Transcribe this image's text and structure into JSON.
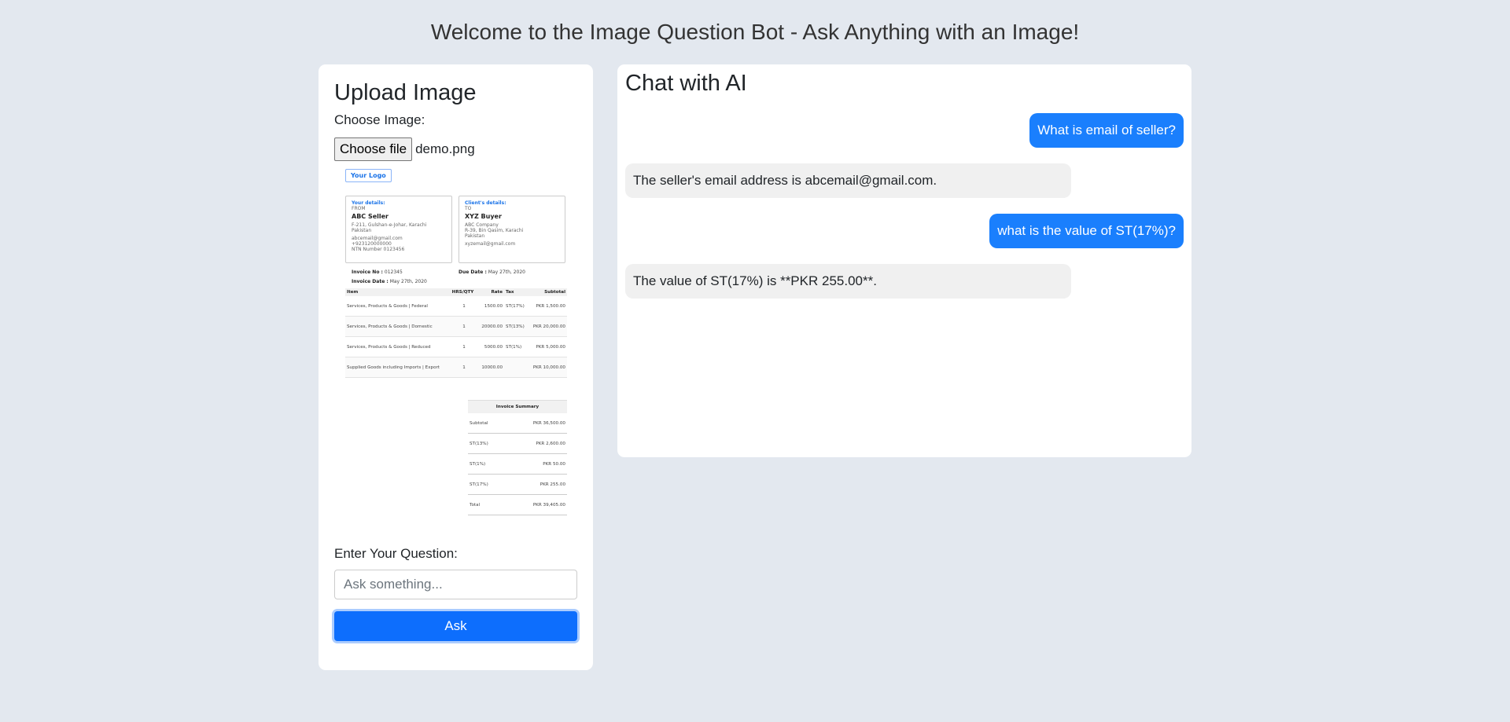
{
  "page": {
    "title": "Welcome to the Image Question Bot - Ask Anything with an Image!"
  },
  "upload": {
    "title": "Upload Image",
    "choose_label": "Choose Image:",
    "file_button": "Choose file",
    "file_name": "demo.png",
    "question_label": "Enter Your Question:",
    "question_placeholder": "Ask something...",
    "ask_button": "Ask"
  },
  "invoice": {
    "logo": "Your Logo",
    "seller": {
      "header": "Your details:",
      "from": "FROM",
      "name": "ABC Seller",
      "address1": "F-211, Gulshan-e-Johar, Karachi",
      "address2": "Pakistan",
      "email": "abcemail@gmail.com",
      "phone": "+923120000000",
      "ntn": "NTN Number 0123456"
    },
    "client": {
      "header": "Client's details:",
      "to": "TO",
      "name": "XYZ Buyer",
      "company": "ABC Company",
      "address1": "R-39, Bin Qasim, Karachi",
      "address2": "Pakistan",
      "email": "xyzemail@gmail.com"
    },
    "invoice_no_label": "Invoice No :",
    "invoice_no": "012345",
    "due_date_label": "Due Date :",
    "due_date": "May 27th, 2020",
    "invoice_date_label": "Invoice Date :",
    "invoice_date": "May 27th, 2020",
    "columns": [
      "Item",
      "HRS/QTY",
      "Rate",
      "Tax",
      "Subtotal"
    ],
    "rows": [
      {
        "item": "Services, Products & Goods | Federal",
        "qty": "1",
        "rate": "1500.00",
        "tax": "ST(17%)",
        "subtotal": "PKR 1,500.00"
      },
      {
        "item": "Services, Products & Goods | Domestic",
        "qty": "1",
        "rate": "20000.00",
        "tax": "ST(13%)",
        "subtotal": "PKR 20,000.00"
      },
      {
        "item": "Services, Products & Goods | Reduced",
        "qty": "1",
        "rate": "5000.00",
        "tax": "ST(1%)",
        "subtotal": "PKR 5,000.00"
      },
      {
        "item": "Supplied Goods including Imports | Export",
        "qty": "1",
        "rate": "10000.00",
        "tax": "",
        "subtotal": "PKR 10,000.00"
      }
    ],
    "summary_title": "Invoice Summary",
    "summary": [
      {
        "label": "Subtotal",
        "value": "PKR 36,500.00"
      },
      {
        "label": "ST(13%)",
        "value": "PKR 2,600.00"
      },
      {
        "label": "ST(1%)",
        "value": "PKR 50.00"
      },
      {
        "label": "ST(17%)",
        "value": "PKR 255.00"
      },
      {
        "label": "Total",
        "value": "PKR 39,405.00"
      }
    ]
  },
  "chat": {
    "title": "Chat with AI",
    "messages": [
      {
        "role": "user",
        "text": "What is email of seller?"
      },
      {
        "role": "bot",
        "text": "The seller's email address is abcemail@gmail.com."
      },
      {
        "role": "user",
        "text": "what is the value of ST(17%)?"
      },
      {
        "role": "bot",
        "text": "The value of ST(17%) is **PKR 255.00**."
      }
    ]
  },
  "colors": {
    "background": "#e3e8ef",
    "primary": "#0d6efd",
    "user_bubble": "#1a7ffd",
    "bot_bubble": "#f0f0f0"
  }
}
